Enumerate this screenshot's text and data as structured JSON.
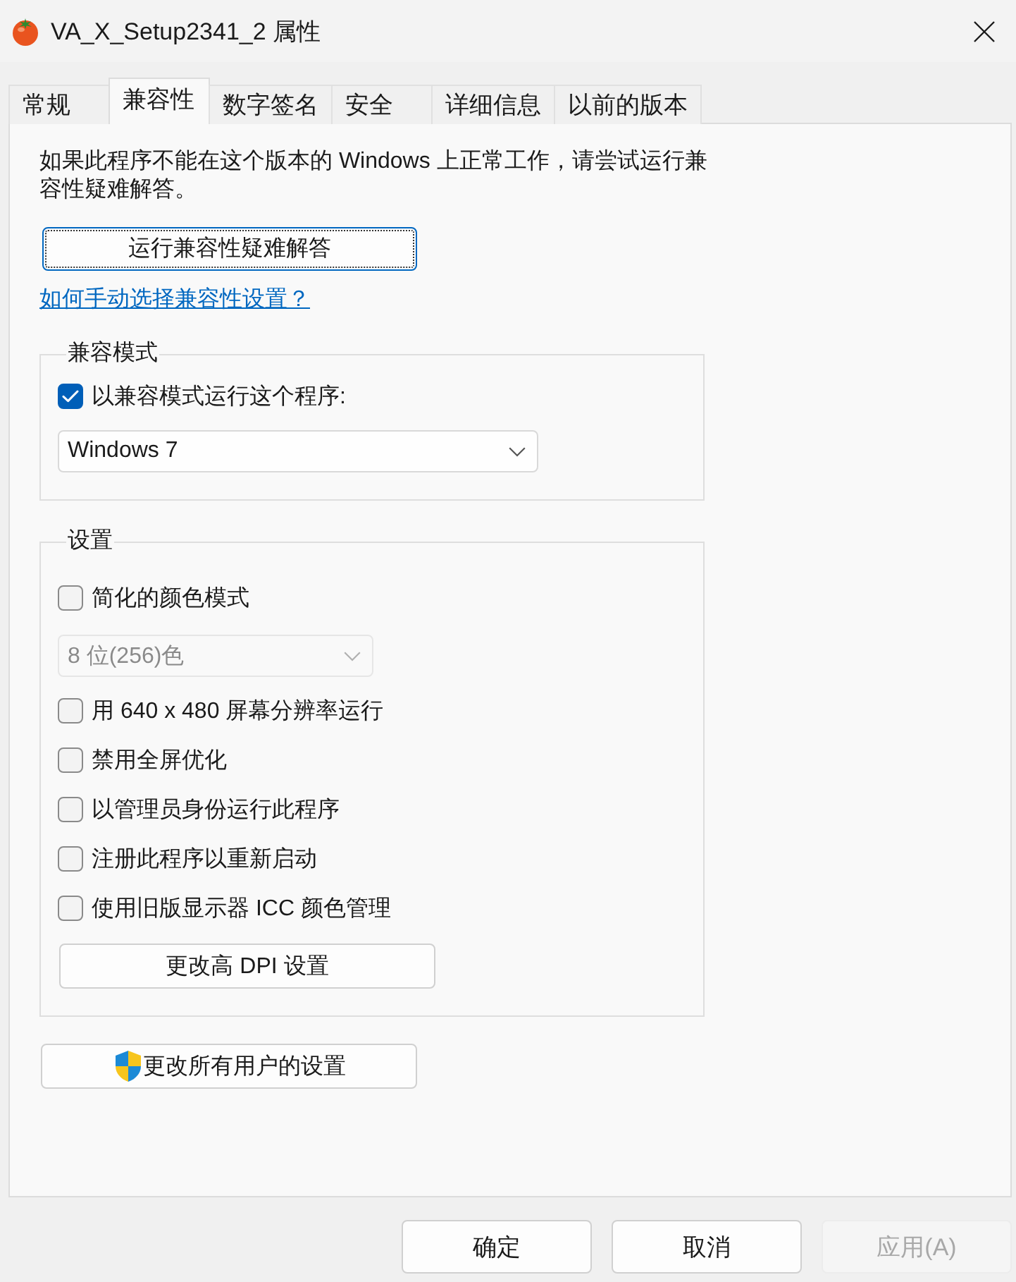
{
  "window": {
    "title": "VA_X_Setup2341_2 属性"
  },
  "tabs": [
    {
      "label": "常规",
      "selected": false
    },
    {
      "label": "兼容性",
      "selected": true
    },
    {
      "label": "数字签名",
      "selected": false
    },
    {
      "label": "安全",
      "selected": false
    },
    {
      "label": "详细信息",
      "selected": false
    },
    {
      "label": "以前的版本",
      "selected": false
    }
  ],
  "intro": "如果此程序不能在这个版本的 Windows 上正常工作，请尝试运行兼容性疑难解答。",
  "troubleshoot_button": {
    "label": "运行兼容性疑难解答",
    "focused": true
  },
  "help_link": "如何手动选择兼容性设置？",
  "compat_group": {
    "title": "兼容模式",
    "checkbox": {
      "label": "以兼容模式运行这个程序:",
      "checked": true
    },
    "dropdown": {
      "value": "Windows 7",
      "disabled": false
    }
  },
  "settings_group": {
    "title": "设置",
    "items": [
      {
        "kind": "checkbox",
        "label": "简化的颜色模式",
        "checked": false
      },
      {
        "kind": "dropdown",
        "value": "8 位(256)色",
        "disabled": true
      },
      {
        "kind": "checkbox",
        "label": "用 640 x 480 屏幕分辨率运行",
        "checked": false
      },
      {
        "kind": "checkbox",
        "label": "禁用全屏优化",
        "checked": false
      },
      {
        "kind": "checkbox",
        "label": "以管理员身份运行此程序",
        "checked": false
      },
      {
        "kind": "checkbox",
        "label": "注册此程序以重新启动",
        "checked": false
      },
      {
        "kind": "checkbox",
        "label": "使用旧版显示器 ICC 颜色管理",
        "checked": false
      },
      {
        "kind": "button",
        "label": "更改高 DPI 设置"
      }
    ]
  },
  "all_users_button": {
    "label": "更改所有用户的设置"
  },
  "footer_buttons": [
    {
      "label": "确定",
      "disabled": false
    },
    {
      "label": "取消",
      "disabled": false
    },
    {
      "label": "应用(A)",
      "disabled": true
    }
  ]
}
